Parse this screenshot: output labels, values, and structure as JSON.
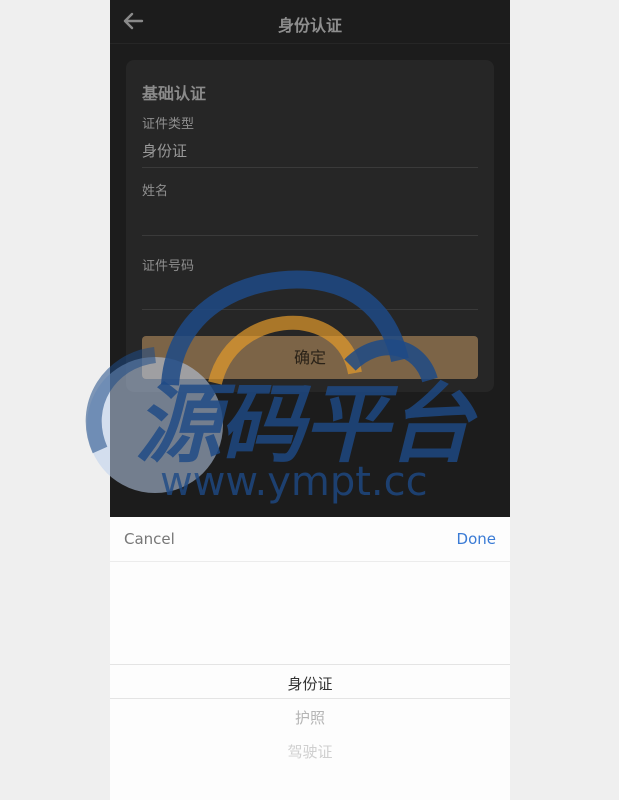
{
  "header": {
    "title": "身份认证",
    "back_icon": "back-arrow-icon"
  },
  "card": {
    "title": "基础认证",
    "fields": [
      {
        "label": "证件类型",
        "value": "身份证"
      },
      {
        "label": "姓名",
        "value": ""
      },
      {
        "label": "证件号码",
        "value": ""
      }
    ],
    "confirm_label": "确定"
  },
  "picker": {
    "cancel_label": "Cancel",
    "done_label": "Done",
    "options": [
      "身份证",
      "护照",
      "驾驶证"
    ],
    "selected": "身份证"
  },
  "watermark": {
    "text_cn": "源码平台",
    "text_url": "www.ympt.cc"
  },
  "colors": {
    "accent": "#7c6447",
    "done": "#3a7bd5",
    "watermark_blue": "#1e4a86",
    "watermark_orange": "#e39a2b"
  }
}
